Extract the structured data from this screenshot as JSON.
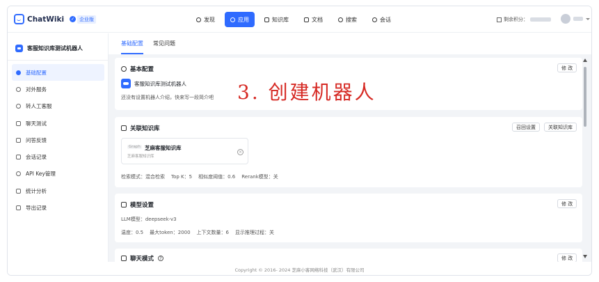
{
  "header": {
    "logo_text": "ChatWiki",
    "edition_badge": "企业版",
    "credits_label": "剩余积分：",
    "user_name": "",
    "nav": [
      {
        "label": "发现",
        "icon": "compass-icon"
      },
      {
        "label": "应用",
        "icon": "app-icon",
        "active": true
      },
      {
        "label": "知识库",
        "icon": "book-icon"
      },
      {
        "label": "文档",
        "icon": "document-icon"
      },
      {
        "label": "搜索",
        "icon": "search-icon"
      },
      {
        "label": "会话",
        "icon": "chat-icon"
      }
    ]
  },
  "sidebar": {
    "robot_name": "客服知识库测试机器人",
    "items": [
      {
        "label": "基础配置",
        "active": true
      },
      {
        "label": "对外服务"
      },
      {
        "label": "转人工客服"
      },
      {
        "label": "聊天测试"
      },
      {
        "label": "问答反馈"
      },
      {
        "label": "会话记录"
      },
      {
        "label": "API Key管理"
      },
      {
        "label": "统计分析"
      },
      {
        "label": "导出记录"
      }
    ]
  },
  "tabs": [
    {
      "label": "基础配置",
      "active": true
    },
    {
      "label": "常见问题"
    }
  ],
  "basic_config": {
    "title": "基本配置",
    "edit_label": "修 改",
    "robot_name": "客服知识库测试机器人",
    "intro_placeholder": "还没有设置机器人介绍，快来写一段简介吧"
  },
  "knowledge": {
    "title": "关联知识库",
    "recall_btn": "召回设置",
    "link_btn": "关联知识库",
    "kb_tag": "Graph",
    "kb_name": "芝麻客服知识库",
    "kb_sub": "芝麻客服知识库",
    "stats": [
      "检索模式：混合检索",
      "Top K：5",
      "相似度阈值：0.6",
      "Rerank模型：关"
    ]
  },
  "model": {
    "title": "模型设置",
    "edit_label": "修 改",
    "llm": "LLM模型：deepseek-v3",
    "stats": [
      "温度：0.5",
      "最大token：2000",
      "上下文数量：6",
      "显示推理过程：关"
    ]
  },
  "chat_mode": {
    "title": "聊天模式",
    "help": "?",
    "edit_label": "修 改"
  },
  "overlay_text": "3. 创建机器人",
  "footer": "Copyright © 2016- 2024 芝麻小客网络科技（武汉）有限公司",
  "colors": {
    "accent": "#2f6bff",
    "overlay": "#d62a24",
    "content_bg": "#f2f4f7"
  }
}
